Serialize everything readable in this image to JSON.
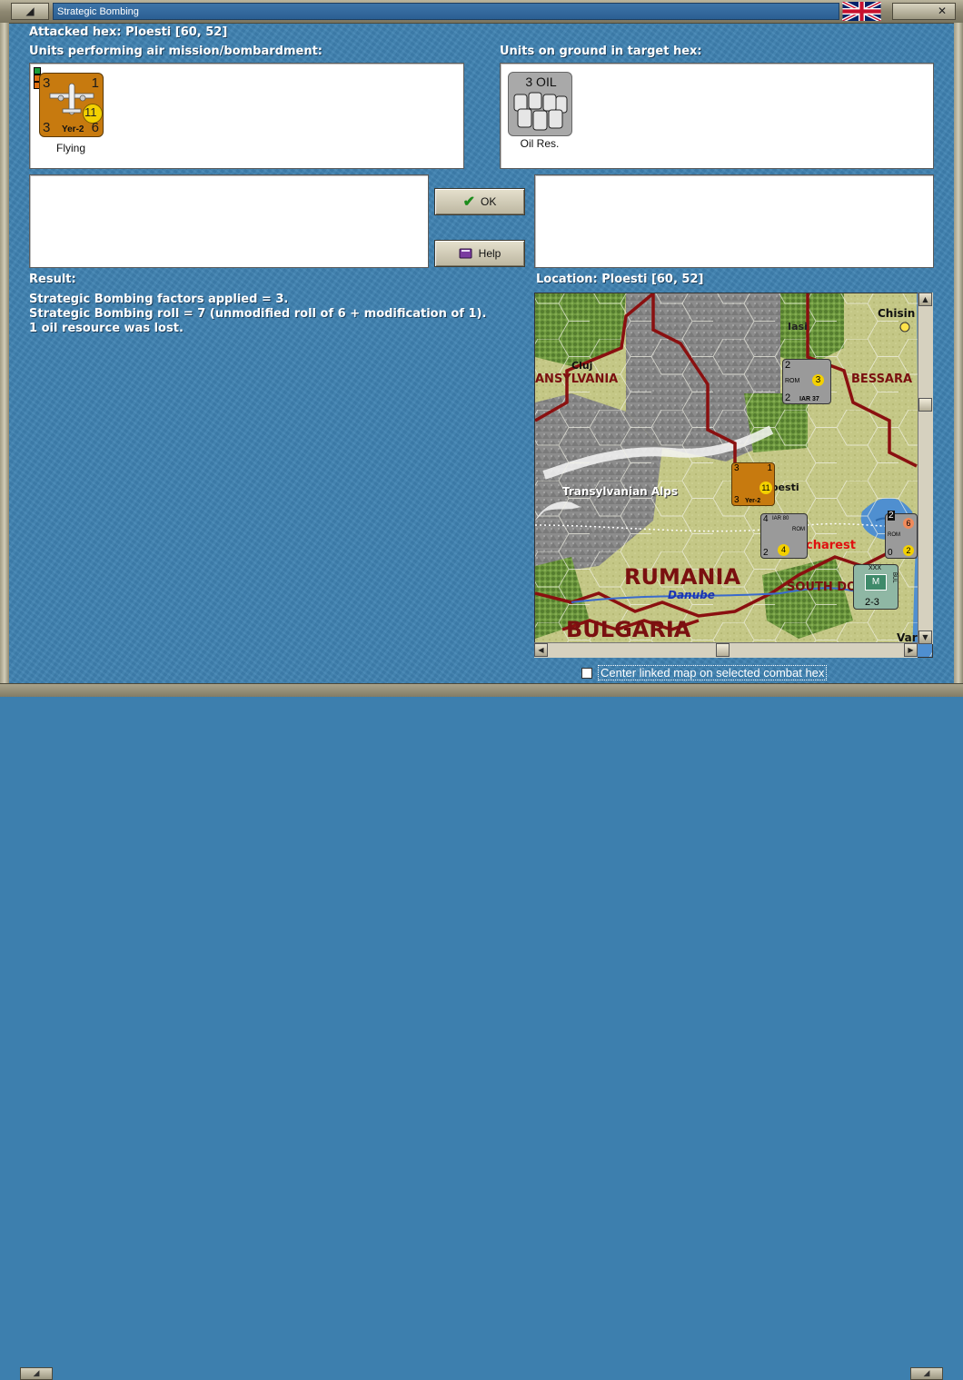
{
  "window": {
    "title": "Strategic Bombing",
    "flag_icon": "uk-flag-icon"
  },
  "header": {
    "attacked_hex": "Attacked hex: Ploesti  [60, 52]"
  },
  "air_units": {
    "label": "Units performing air mission/bombardment:",
    "units": [
      {
        "name": "Yer-2",
        "attack": "3",
        "top_right": "1",
        "bottom_left": "3",
        "bottom_right": "6",
        "range": "11",
        "status": "Flying",
        "color": "#c77a0f"
      }
    ]
  },
  "ground_units": {
    "label": "Units on ground in target hex:",
    "units": [
      {
        "name": "Oil Res.",
        "value": "3 OIL",
        "color": "#a9a9a9"
      }
    ]
  },
  "buttons": {
    "ok": "OK",
    "help": "Help"
  },
  "result": {
    "label": "Result:",
    "lines": [
      "Strategic Bombing factors applied = 3.",
      "Strategic Bombing roll = 7 (unmodified roll of 6 + modification of 1).",
      "1 oil resource was lost."
    ]
  },
  "map": {
    "location_label": "Location:  Ploesti  [60, 52]",
    "places": {
      "iasi": "Iasi",
      "chisinau": "Chisin",
      "cluj": "Cluj",
      "transylvania": "ANSYLVANIA",
      "bessarabia": "BESSARA",
      "alps": "Transylvanian Alps",
      "ploesti": "oesti",
      "bucharest": "charest",
      "rumania": "RUMANIA",
      "danube": "Danube",
      "south_dobruja": "SOUTH DO",
      "bulgaria": "BULGARIA",
      "varna": "Var"
    },
    "counters": {
      "rom_air1": {
        "top_left": "2",
        "num": "3",
        "sub": "ROM",
        "name": "IAR 37",
        "bottom_left": "2"
      },
      "yer2": {
        "a": "3",
        "b": "1",
        "c": "3",
        "range": "11",
        "name": "Yer-2"
      },
      "rom_air2": {
        "top_left": "4",
        "name": "IAR 80",
        "sub": "ROM",
        "bottom_left": "2",
        "num": "4"
      },
      "rom_air3": {
        "a": "2",
        "b": "6",
        "sub": "ROM",
        "c": "0",
        "d": "2"
      },
      "hq": {
        "top": "XXX",
        "letter": "M",
        "side": "BUL",
        "bottom": "2-3"
      }
    },
    "checkbox_label": "Center linked map on selected combat hex",
    "checkbox_checked": false
  }
}
